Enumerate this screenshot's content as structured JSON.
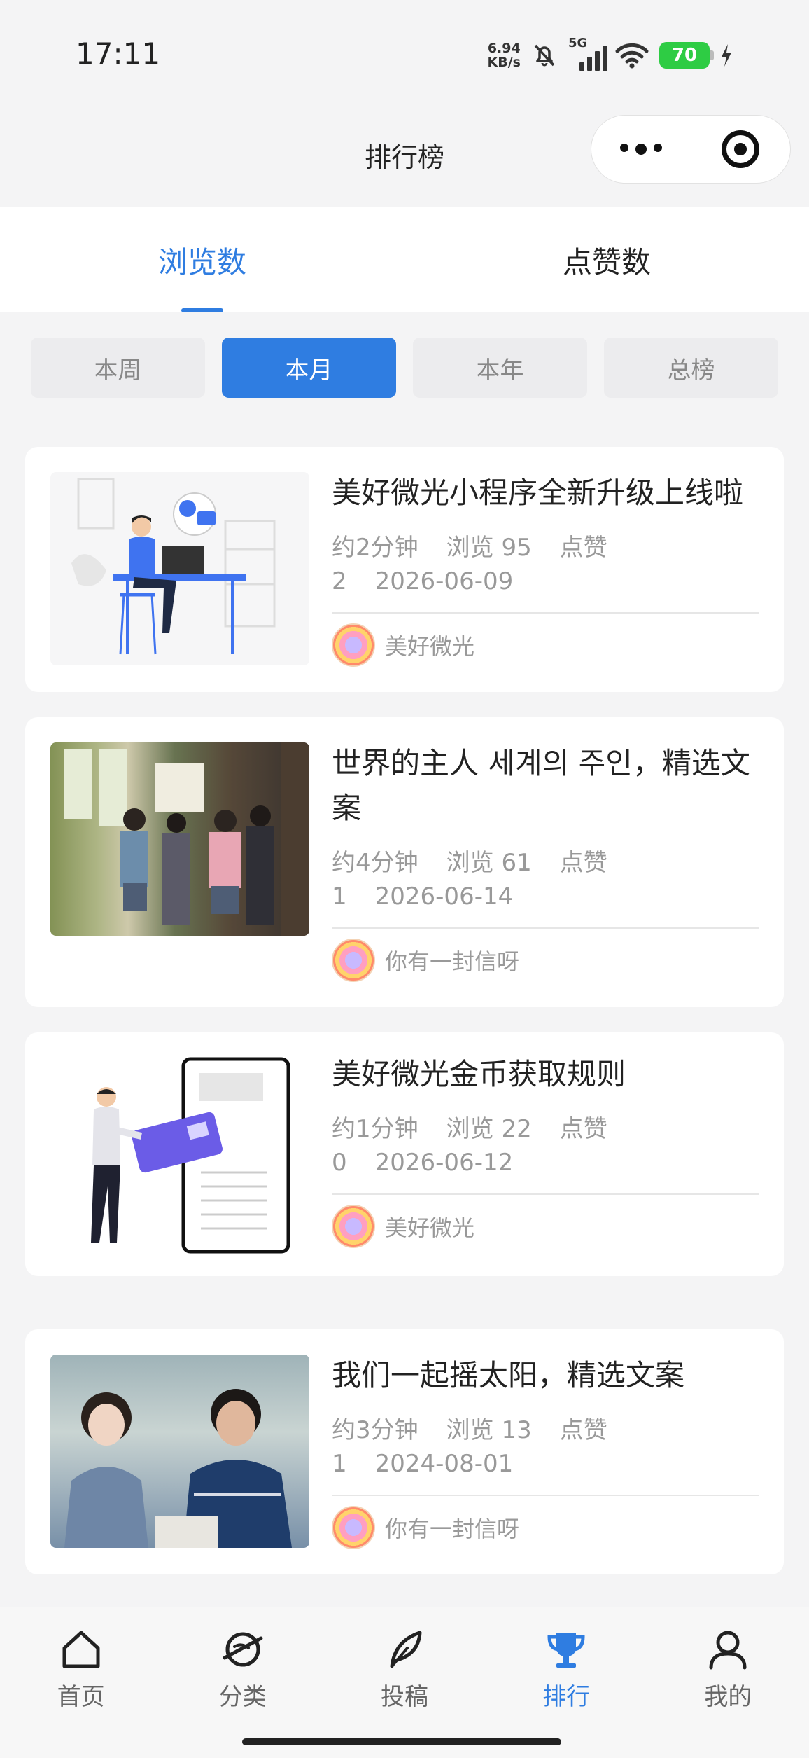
{
  "status_bar": {
    "time": "17:11",
    "net_speed_value": "6.94",
    "net_speed_unit": "KB/s",
    "network": "5G",
    "battery": "70"
  },
  "nav": {
    "title": "排行榜"
  },
  "tabs": [
    {
      "label": "浏览数",
      "active": true
    },
    {
      "label": "点赞数",
      "active": false
    }
  ],
  "periods": [
    {
      "label": "本周",
      "active": false
    },
    {
      "label": "本月",
      "active": true
    },
    {
      "label": "本年",
      "active": false
    },
    {
      "label": "总榜",
      "active": false
    }
  ],
  "articles": [
    {
      "title": "美好微光小程序全新升级上线啦",
      "read_time": "约2分钟",
      "views": "浏览 95",
      "likes": "点赞 2",
      "date": "2026-06-09",
      "author": "美好微光",
      "image": "illustration-person-laptop"
    },
    {
      "title": "世界的主人 세계의 주인，精选文案",
      "read_time": "约4分钟",
      "views": "浏览 61",
      "likes": "点赞 1",
      "date": "2026-06-14",
      "author": "你有一封信呀",
      "image": "photo-school-hallway"
    },
    {
      "title": "美好微光金币获取规则",
      "read_time": "约1分钟",
      "views": "浏览 22",
      "likes": "点赞 0",
      "date": "2026-06-12",
      "author": "美好微光",
      "image": "illustration-card-phone"
    },
    {
      "title": "我们一起摇太阳，精选文案",
      "read_time": "约3分钟",
      "views": "浏览 13",
      "likes": "点赞 1",
      "date": "2024-08-01",
      "author": "你有一封信呀",
      "image": "photo-two-people"
    }
  ],
  "bottom_tabs": [
    {
      "label": "首页",
      "icon": "home-icon",
      "active": false
    },
    {
      "label": "分类",
      "icon": "planet-icon",
      "active": false
    },
    {
      "label": "投稿",
      "icon": "feather-icon",
      "active": false
    },
    {
      "label": "排行",
      "icon": "trophy-icon",
      "active": true
    },
    {
      "label": "我的",
      "icon": "user-icon",
      "active": false
    }
  ],
  "colors": {
    "accent": "#2f7de1",
    "background": "#f4f4f5"
  }
}
